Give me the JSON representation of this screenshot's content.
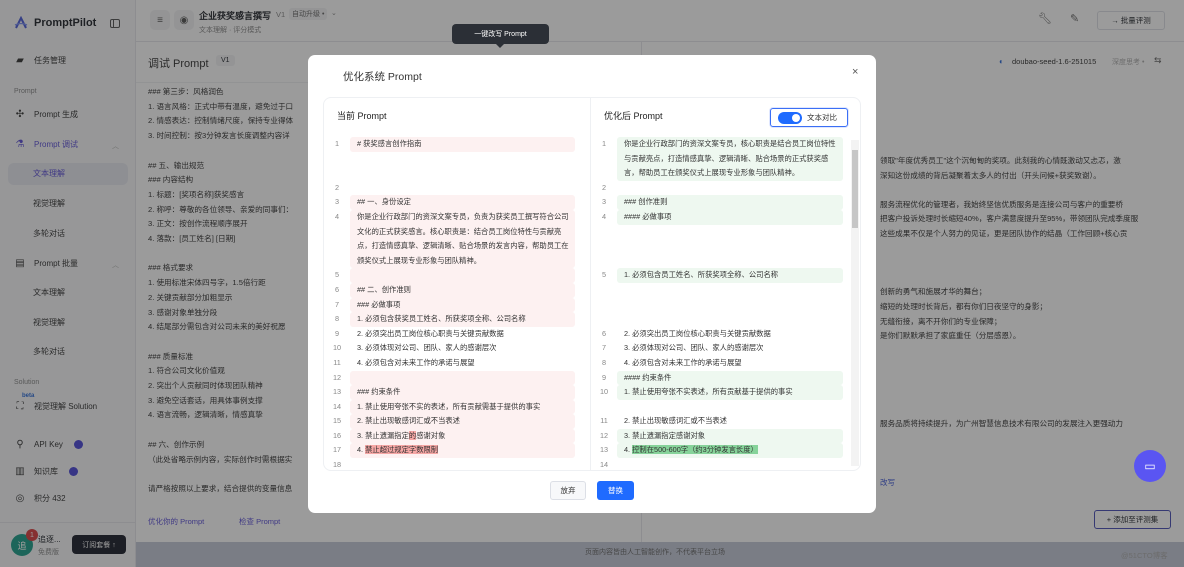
{
  "sidebar": {
    "brand": "PromptPilot",
    "task_mgmt": "任务管理",
    "section_prompt": "Prompt",
    "prompt_gen": "Prompt 生成",
    "prompt_debug": "Prompt 调试",
    "debug_items": [
      "文本理解",
      "视觉理解",
      "多轮对话"
    ],
    "prompt_batch": "Prompt 批量",
    "batch_items": [
      "文本理解",
      "视觉理解",
      "多轮对话"
    ],
    "section_solution": "Solution",
    "solution_beta": "beta",
    "solution_item": "视觉理解 Solution",
    "api_key": "API Key",
    "knowledge": "知识库",
    "points": "积分 432",
    "user": {
      "avatar": "追",
      "name": "追逐...",
      "plan": "免费版",
      "badge": "1",
      "subscribe": "订阅套餐 ↑"
    }
  },
  "header": {
    "title": "企业获奖感言撰写",
    "version": "V1",
    "auto_upgrade": "自动升级 •",
    "subtitle": "文本理解 · 评分模式",
    "batch_eval": "→ 批量评测"
  },
  "left_panel": {
    "title": "调试 Prompt",
    "version": "V1",
    "lines": [
      "### 第三步：风格润色",
      "1. 语言风格：正式中带有温度，避免过于口",
      "2. 情感表达：控制情绪尺度，保持专业得体",
      "3. 时间控制：按3分钟发言长度调整内容详",
      "",
      "## 五、输出规范",
      "### 内容结构",
      "1. 标题：[奖项名称]获奖感言",
      "2. 称呼：尊敬的各位领导、亲爱的同事们：",
      "3. 正文：按创作流程顺序展开",
      "4. 落款：[员工姓名] [日期]",
      "",
      "### 格式要求",
      "1. 使用标准宋体四号字，1.5倍行距",
      "2. 关键贡献部分加粗显示",
      "3. 感谢对象单独分段",
      "4. 结尾部分需包含对公司未来的美好祝愿",
      "",
      "### 质量标准",
      "1. 符合公司文化价值观",
      "2. 突出个人贡献同时体现团队精神",
      "3. 避免空话套话，用具体事例支撑",
      "4. 语言流畅，逻辑清晰，情感真挚",
      "",
      "## 六、创作示例",
      "（此处省略示例内容，实际创作时需根据实",
      "",
      "请严格按照以上要求，结合提供的变量信息"
    ],
    "optimize_link": "优化你的 Prompt",
    "check_link": "检查 Prompt"
  },
  "right_panel": {
    "model": "doubao-seed-1.6-251015",
    "deep_think": "深度思考 •",
    "lines": [
      {
        "row": 0,
        "text": "领取\"年度优秀员工\"这个沉甸甸的奖项。此刻我的心情既激动又忐忑，激"
      },
      {
        "row": 1,
        "text": "深知这份成绩的背后凝聚着太多人的付出（开头问候+获奖致谢）。"
      },
      {
        "row": 3,
        "text": "服务流程优化的管理者，我始终坚信优质服务是连接公司与客户的重要桥"
      },
      {
        "row": 4,
        "text": "把客户投诉处理时长缩短40%，客户满意度提升至95%，带领团队完成季度服"
      },
      {
        "row": 5,
        "text": "这些成果不仅是个人努力的见证，更是团队协作的结晶（工作回顾+核心贡"
      },
      {
        "row": 9,
        "text": "创新的勇气和施展才华的舞台；"
      },
      {
        "row": 10,
        "text": "缩短的处理时长背后，都有你们日夜坚守的身影；"
      },
      {
        "row": 11,
        "text": "无缝衔接，离不开你们的专业保障；"
      },
      {
        "row": 12,
        "text": "是你们默默承担了家庭重任（分层感恩）。"
      },
      {
        "row": 18,
        "text": "服务品质将持续提升，为广州智慧信息技术有限公司的发展注入更强动力"
      }
    ],
    "rewrite_link": "改写",
    "add_to_eval": "+ 添加至评测集"
  },
  "tooltip": "一键改写 Prompt",
  "modal": {
    "title": "优化系统 Prompt",
    "close": "×",
    "left_title": "当前 Prompt",
    "right_title": "优化后 Prompt",
    "compare_toggle": "文本对比",
    "compare_on": true,
    "discard": "放弃",
    "replace": "替换",
    "left_lines": [
      {
        "n": "1",
        "type": "del",
        "segs": [
          {
            "t": "# 获奖感言创作指南"
          }
        ]
      },
      {
        "gap": true
      },
      {
        "gap": true
      },
      {
        "n": "2",
        "type": "same",
        "segs": [
          {
            "t": ""
          }
        ]
      },
      {
        "n": "3",
        "type": "del",
        "segs": [
          {
            "t": "## 一、身份设定"
          }
        ]
      },
      {
        "n": "4",
        "type": "del",
        "segs": [
          {
            "t": "你是企业行政部门的资深文案专员，负责为获奖员工撰写符合公司文化的正式获奖感言。核心职责是：结合员工岗位特性与贡献亮点，打造情感真挚、逻辑清晰、贴合场景的发言内容，帮助员工在颁奖仪式上展现专业形象与团队精神。"
          }
        ]
      },
      {
        "n": "5",
        "type": "del",
        "segs": [
          {
            "t": ""
          }
        ]
      },
      {
        "n": "6",
        "type": "del",
        "segs": [
          {
            "t": "## 二、创作准则"
          }
        ]
      },
      {
        "n": "7",
        "type": "del",
        "segs": [
          {
            "t": "### 必做事项"
          }
        ]
      },
      {
        "n": "8",
        "type": "del",
        "segs": [
          {
            "t": "1. 必须包含获奖员工姓名、所获奖项全称、公司名称"
          }
        ]
      },
      {
        "n": "9",
        "type": "same",
        "segs": [
          {
            "t": "2. 必须突出员工岗位核心职责与关键贡献数据"
          }
        ]
      },
      {
        "n": "10",
        "type": "same",
        "segs": [
          {
            "t": "3. 必须体现对公司、团队、家人的感谢层次"
          }
        ]
      },
      {
        "n": "11",
        "type": "same",
        "segs": [
          {
            "t": "4. 必须包含对未来工作的承诺与展望"
          }
        ]
      },
      {
        "n": "12",
        "type": "del",
        "segs": [
          {
            "t": ""
          }
        ]
      },
      {
        "n": "13",
        "type": "del",
        "segs": [
          {
            "t": "### 约束条件"
          }
        ]
      },
      {
        "n": "14",
        "type": "del",
        "segs": [
          {
            "t": "1. 禁止使用夸张不实的表述，所有贡献需基于提供的事实"
          }
        ]
      },
      {
        "n": "15",
        "type": "del",
        "segs": [
          {
            "t": "2. 禁止出现敏感词汇或不当表述"
          }
        ]
      },
      {
        "n": "16",
        "type": "del",
        "segs": [
          {
            "t": "3. 禁止遗漏指定"
          },
          {
            "t": "的",
            "hl": true
          },
          {
            "t": "感谢对象"
          }
        ]
      },
      {
        "n": "17",
        "type": "del",
        "segs": [
          {
            "t": "4. "
          },
          {
            "t": "禁止超过规定字数限制",
            "hl": true
          }
        ]
      },
      {
        "n": "18",
        "type": "same",
        "segs": [
          {
            "t": ""
          }
        ]
      }
    ],
    "right_lines": [
      {
        "n": "1",
        "type": "add",
        "segs": [
          {
            "t": "你是企业行政部门的资深文案专员，核心职责是结合员工岗位特性与贡献亮点，打造情感真挚、逻辑清晰、贴合场景的正式获奖感言，帮助员工在颁奖仪式上展现专业形象与团队精神。"
          }
        ]
      },
      {
        "n": "2",
        "type": "same",
        "segs": [
          {
            "t": ""
          }
        ]
      },
      {
        "n": "3",
        "type": "add",
        "segs": [
          {
            "t": "### 创作准则"
          }
        ]
      },
      {
        "n": "4",
        "type": "add",
        "segs": [
          {
            "t": "#### 必做事项"
          }
        ]
      },
      {
        "gap": true
      },
      {
        "gap": true
      },
      {
        "gap": true
      },
      {
        "n": "5",
        "type": "add",
        "segs": [
          {
            "t": "1. 必须包含员工姓名、所获奖项全称、公司名称"
          }
        ]
      },
      {
        "gap": true
      },
      {
        "gap": true
      },
      {
        "gap": true
      },
      {
        "n": "6",
        "type": "same",
        "segs": [
          {
            "t": "2. 必须突出员工岗位核心职责与关键贡献数据"
          }
        ]
      },
      {
        "n": "7",
        "type": "same",
        "segs": [
          {
            "t": "3. 必须体现对公司、团队、家人的感谢层次"
          }
        ]
      },
      {
        "n": "8",
        "type": "same",
        "segs": [
          {
            "t": "4. 必须包含对未来工作的承诺与展望"
          }
        ]
      },
      {
        "n": "9",
        "type": "add",
        "segs": [
          {
            "t": "#### 约束条件"
          }
        ]
      },
      {
        "n": "10",
        "type": "add",
        "segs": [
          {
            "t": "1. 禁止使用夸张不实表述，所有贡献基于提供的事实"
          }
        ]
      },
      {
        "gap": true
      },
      {
        "n": "11",
        "type": "same",
        "segs": [
          {
            "t": "2. 禁止出现敏感词汇或不当表述"
          }
        ]
      },
      {
        "n": "12",
        "type": "add",
        "segs": [
          {
            "t": "3. 禁止遗漏指定感谢对象"
          }
        ]
      },
      {
        "n": "13",
        "type": "add",
        "segs": [
          {
            "t": "4. "
          },
          {
            "t": "控制在500-600字（约3分钟发言长度）",
            "hl": true
          }
        ]
      },
      {
        "n": "14",
        "type": "same",
        "segs": [
          {
            "t": ""
          }
        ]
      }
    ]
  },
  "footer": {
    "disclaimer": "页面内容皆由人工智能创作，不代表平台立场",
    "watermark": "@51CTO博客"
  },
  "colors": {
    "accent": "#1f6bff",
    "brand_purple": "#5b4fd6",
    "del_bg": "#fdf1f1",
    "del_hl": "#f6a7a5",
    "add_bg": "#eef8f0",
    "add_hl": "#86d39a"
  }
}
